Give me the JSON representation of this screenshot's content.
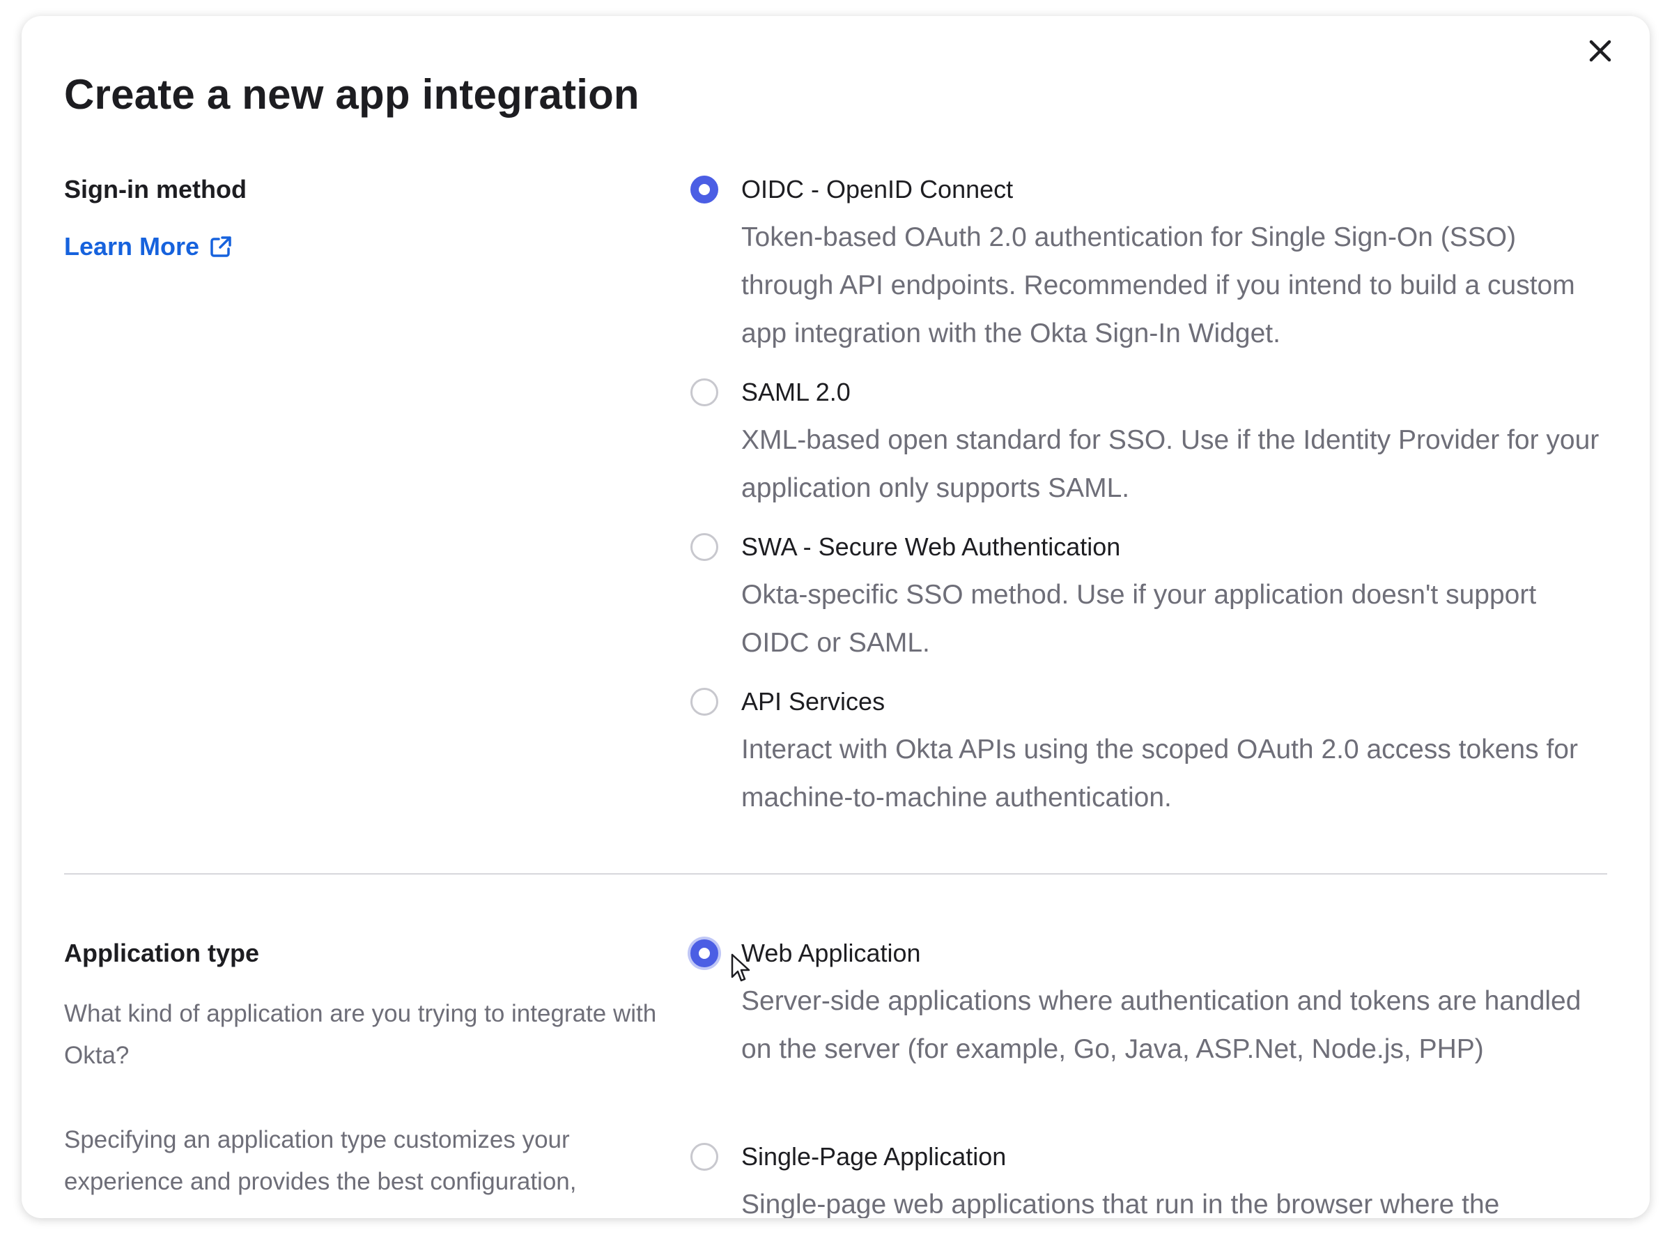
{
  "modal": {
    "title": "Create a new app integration",
    "close_icon": "close-icon"
  },
  "sign_in": {
    "label": "Sign-in method",
    "learn_more": "Learn More",
    "learn_more_icon": "external-link-icon",
    "options": [
      {
        "label": "OIDC - OpenID Connect",
        "description": "Token-based OAuth 2.0 authentication for Single Sign-On (SSO) through API endpoints. Recommended if you intend to build a custom app integration with the Okta Sign-In Widget.",
        "selected": true
      },
      {
        "label": "SAML 2.0",
        "description": "XML-based open standard for SSO. Use if the Identity Provider for your application only supports SAML.",
        "selected": false
      },
      {
        "label": "SWA - Secure Web Authentication",
        "description": "Okta-specific SSO method. Use if your application doesn't support OIDC or SAML.",
        "selected": false
      },
      {
        "label": "API Services",
        "description": "Interact with Okta APIs using the scoped OAuth 2.0 access tokens for machine-to-machine authentication.",
        "selected": false
      }
    ]
  },
  "app_type": {
    "label": "Application type",
    "help_1": "What kind of application are you trying to integrate with Okta?",
    "help_2": "Specifying an application type customizes your experience and provides the best configuration,",
    "options": [
      {
        "label": "Web Application",
        "description": "Server-side applications where authentication and tokens are handled on the server (for example, Go, Java, ASP.Net, Node.js, PHP)",
        "selected": true
      },
      {
        "label": "Single-Page Application",
        "description": "Single-page web applications that run in the browser where the",
        "selected": false
      }
    ]
  },
  "colors": {
    "accent": "#4b5ee4",
    "link": "#1662dd",
    "text": "#1d1d21",
    "muted": "#6e6e78"
  }
}
